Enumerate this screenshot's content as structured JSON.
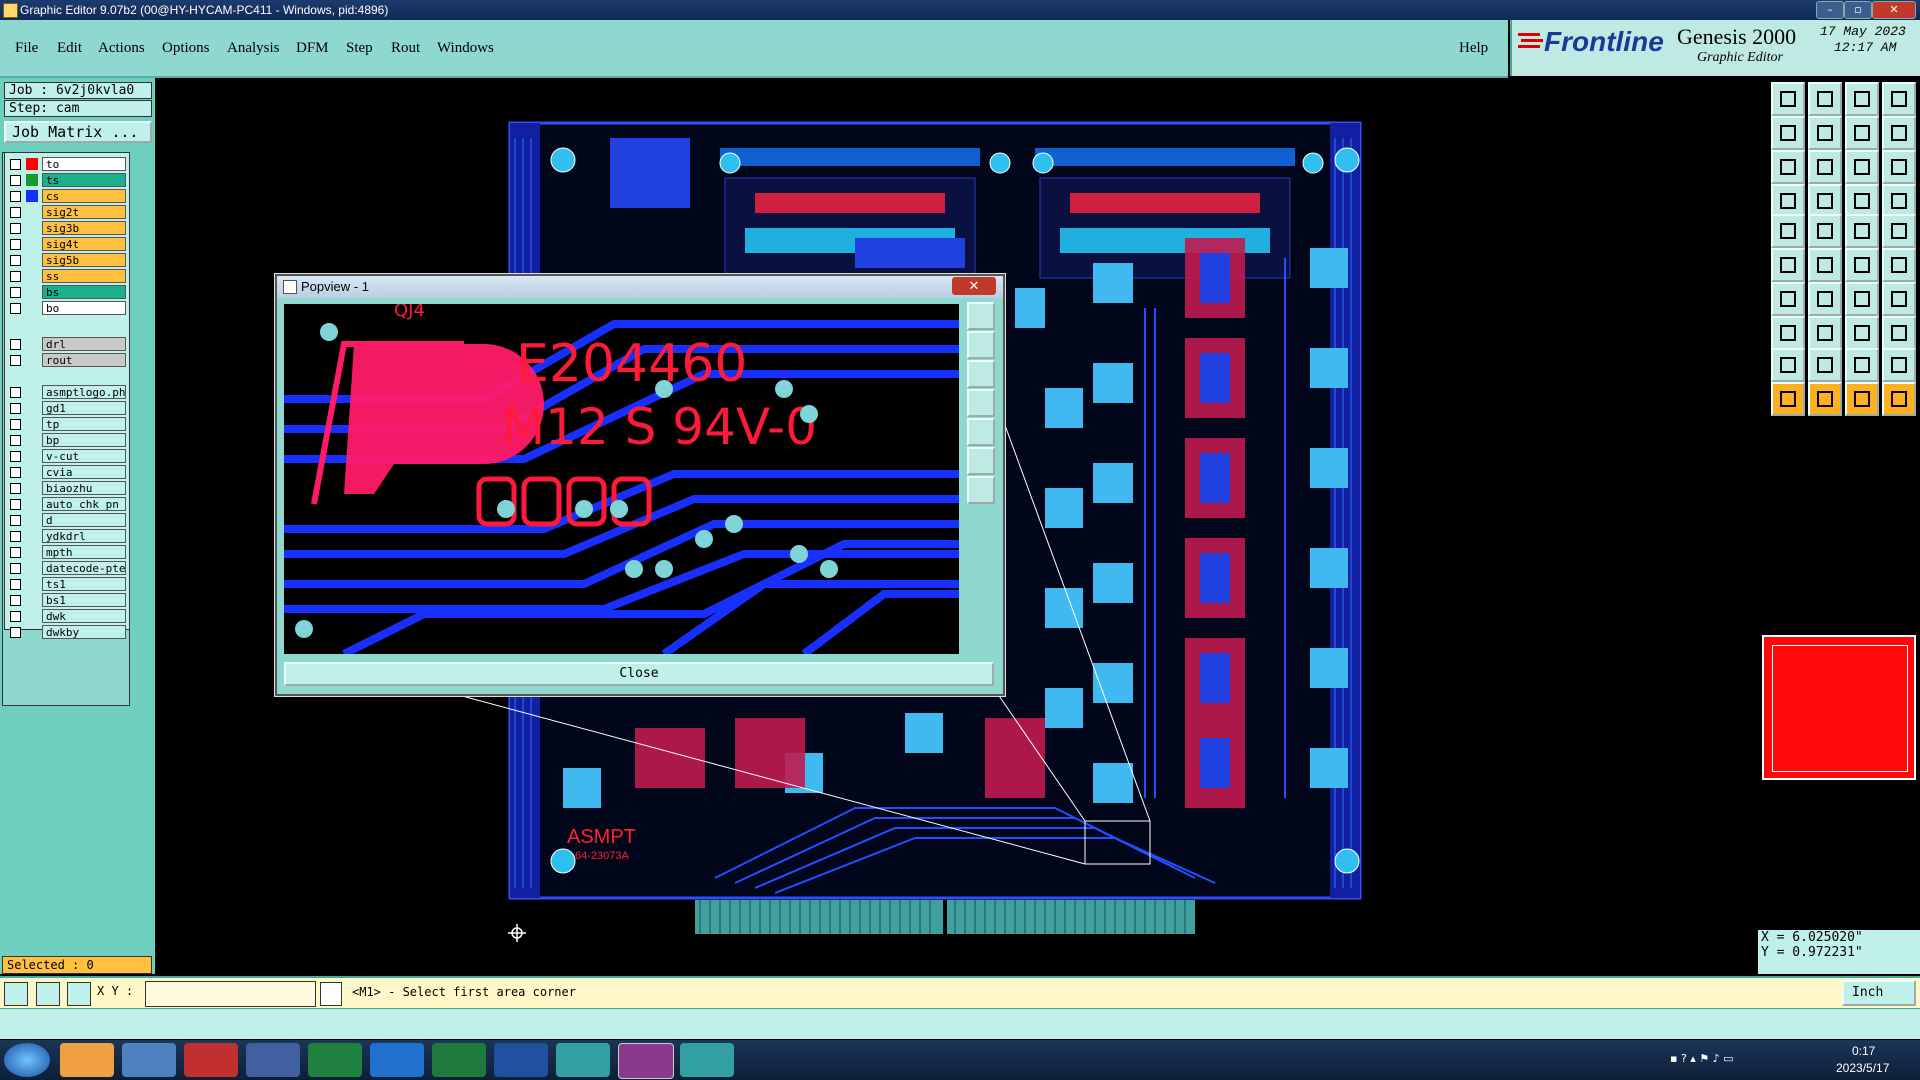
{
  "window": {
    "title": "Graphic Editor 9.07b2 (00@HY-HYCAM-PC411 - Windows, pid:4896)"
  },
  "menu": {
    "items": [
      "File",
      "Edit",
      "Actions",
      "Options",
      "Analysis",
      "DFM",
      "Step",
      "Rout",
      "Windows"
    ],
    "help": "Help"
  },
  "brand": {
    "logo": "Frontline",
    "product": "Genesis 2000",
    "subtitle": "Graphic Editor",
    "date": "17 May 2023",
    "time": "12:17 AM"
  },
  "job": {
    "job_label": "Job : 6v2j0kvla0",
    "step_label": "Step: cam",
    "matrix_button": "Job Matrix ..."
  },
  "layers": [
    {
      "name": "to",
      "color": "#ff0000",
      "bg": "#ffffff"
    },
    {
      "name": "ts",
      "color": "#1a9a2a",
      "bg": "#1ab08a"
    },
    {
      "name": "cs",
      "color": "#1030ff",
      "bg": "#ffc040"
    },
    {
      "name": "sig2t",
      "color": "",
      "bg": "#ffc040"
    },
    {
      "name": "sig3b",
      "color": "",
      "bg": "#ffc040"
    },
    {
      "name": "sig4t",
      "color": "",
      "bg": "#ffc040"
    },
    {
      "name": "sig5b",
      "color": "",
      "bg": "#ffc040"
    },
    {
      "name": "ss",
      "color": "",
      "bg": "#ffc040"
    },
    {
      "name": "bs",
      "color": "",
      "bg": "#1ab08a"
    },
    {
      "name": "bo",
      "color": "",
      "bg": "#ffffff"
    },
    {
      "name": "drl",
      "color": "",
      "bg": "#c8c8c8"
    },
    {
      "name": "rout",
      "color": "",
      "bg": "#c8c8c8"
    },
    {
      "name": "asmptlogo.ph",
      "color": "",
      "bg": "#bff0ea"
    },
    {
      "name": "gd1",
      "color": "",
      "bg": "#bff0ea"
    },
    {
      "name": "tp",
      "color": "",
      "bg": "#bff0ea"
    },
    {
      "name": "bp",
      "color": "",
      "bg": "#bff0ea"
    },
    {
      "name": "v-cut",
      "color": "",
      "bg": "#bff0ea"
    },
    {
      "name": "cvia",
      "color": "",
      "bg": "#bff0ea"
    },
    {
      "name": "biaozhu",
      "color": "",
      "bg": "#bff0ea"
    },
    {
      "name": "auto_chk_pn",
      "color": "",
      "bg": "#bff0ea"
    },
    {
      "name": "d",
      "color": "",
      "bg": "#bff0ea"
    },
    {
      "name": "ydkdrl",
      "color": "",
      "bg": "#bff0ea"
    },
    {
      "name": "mpth",
      "color": "",
      "bg": "#bff0ea"
    },
    {
      "name": "datecode-pte",
      "color": "",
      "bg": "#bff0ea"
    },
    {
      "name": "ts1",
      "color": "",
      "bg": "#bff0ea"
    },
    {
      "name": "bs1",
      "color": "",
      "bg": "#bff0ea"
    },
    {
      "name": "dwk",
      "color": "",
      "bg": "#bff0ea"
    },
    {
      "name": "dwkby",
      "color": "",
      "bg": "#bff0ea"
    }
  ],
  "selected": "Selected : 0",
  "popview": {
    "title": "Popview - 1",
    "board_text_1": "E204460",
    "board_text_2": "M12 S 94V-0",
    "board_text_3": "QJ4",
    "close": "Close"
  },
  "pcb": {
    "label_company": "ASMPT",
    "label_part": "64-23073A"
  },
  "status": {
    "xy_label": "X Y :",
    "xy_value": "",
    "message": "<M1> - Select first area corner",
    "units": "Inch"
  },
  "coords": {
    "x": "X = 6.025020\"",
    "y": "Y = 0.972231\""
  },
  "tray": {
    "time": "0:17",
    "date": "2023/5/17"
  }
}
